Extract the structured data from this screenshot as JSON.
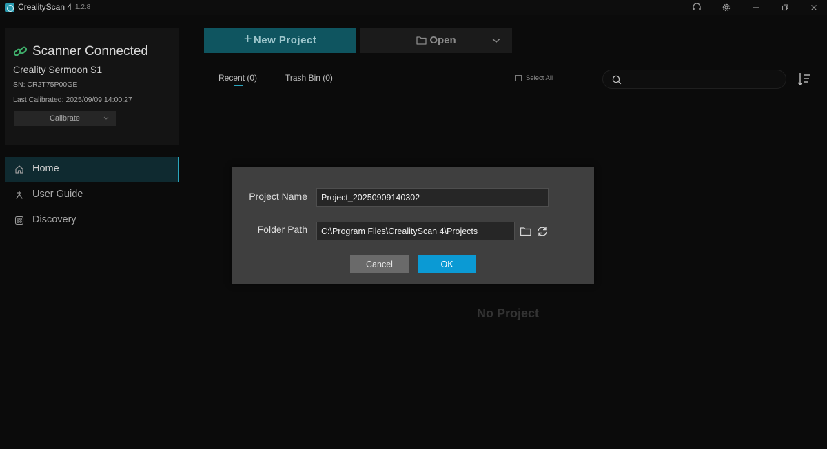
{
  "app": {
    "title": "CrealityScan 4",
    "version": "1.2.8"
  },
  "scanner": {
    "status": "Scanner Connected",
    "model": "Creality Sermoon S1",
    "sn": "SN: CR2T75P00GE",
    "last_calibrated": "Last Calibrated: 2025/09/09 14:00:27",
    "calibrate_label": "Calibrate"
  },
  "nav": {
    "items": [
      {
        "label": "Home",
        "icon": "home-icon",
        "active": true
      },
      {
        "label": "User Guide",
        "icon": "user-guide-icon",
        "active": false
      },
      {
        "label": "Discovery",
        "icon": "discovery-icon",
        "active": false
      }
    ]
  },
  "toolbar": {
    "new_project_label": "New Project",
    "open_label": "Open"
  },
  "tabs": {
    "recent": "Recent (0)",
    "trash": "Trash Bin (0)"
  },
  "list": {
    "select_all_label": "Select All",
    "search_placeholder": "",
    "empty_label": "No Project"
  },
  "dialog": {
    "project_name_label": "Project Name",
    "project_name_value": "Project_20250909140302",
    "folder_path_label": "Folder Path",
    "folder_path_value": "C:\\Program Files\\CrealityScan 4\\Projects",
    "cancel_label": "Cancel",
    "ok_label": "OK"
  },
  "colors": {
    "accent": "#2aa6bd",
    "primary_button": "#0b9ad4",
    "new_project_bg": "#0f5560",
    "dialog_bg": "#3f3f3f",
    "connected_green": "#3fae6b"
  }
}
